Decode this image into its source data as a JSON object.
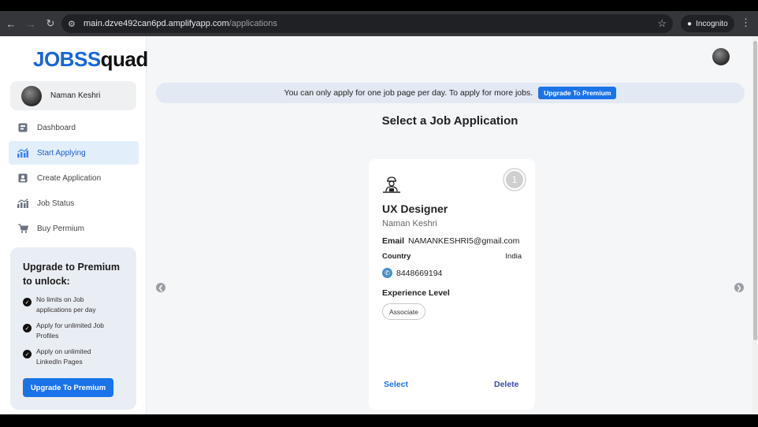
{
  "browser": {
    "url_host": "main.dzve492can6pd.amplifyapp.com",
    "url_path": "/applications",
    "incognito_label": "Incognito"
  },
  "sidebar": {
    "logo_a": "JOBS",
    "logo_b": "quad",
    "user_name": "Naman Keshri",
    "items": [
      {
        "label": "Dashboard",
        "icon": "dashboard-icon"
      },
      {
        "label": "Start Applying",
        "icon": "chart-icon"
      },
      {
        "label": "Create Application",
        "icon": "create-icon"
      },
      {
        "label": "Job Status",
        "icon": "status-icon"
      },
      {
        "label": "Buy Permium",
        "icon": "cart-icon"
      }
    ],
    "upgrade": {
      "title": "Upgrade to Premium to unlock:",
      "features": [
        "No limits on Job applications per day",
        "Apply for unlimited Job Profiles",
        "Apply on unlimited LinkedIn Pages"
      ],
      "button": "Upgrade To Premium"
    }
  },
  "banner": {
    "text": "You can only apply for one job page per day. To apply for more jobs.",
    "button": "Upgrade To Premium"
  },
  "main": {
    "title": "Select a Job Application"
  },
  "card": {
    "badge": "1",
    "job_title": "UX Designer",
    "applicant": "Naman Keshri",
    "email_label": "Email",
    "email": "NAMANKESHRI5@gmail.com",
    "country_label": "Country",
    "country": "India",
    "phone": "8448669194",
    "experience_label": "Experience Level",
    "experience": "Associate",
    "select_label": "Select",
    "delete_label": "Delete"
  },
  "colors": {
    "accent": "#1a73e8",
    "active_nav_bg": "#e3eefb"
  }
}
